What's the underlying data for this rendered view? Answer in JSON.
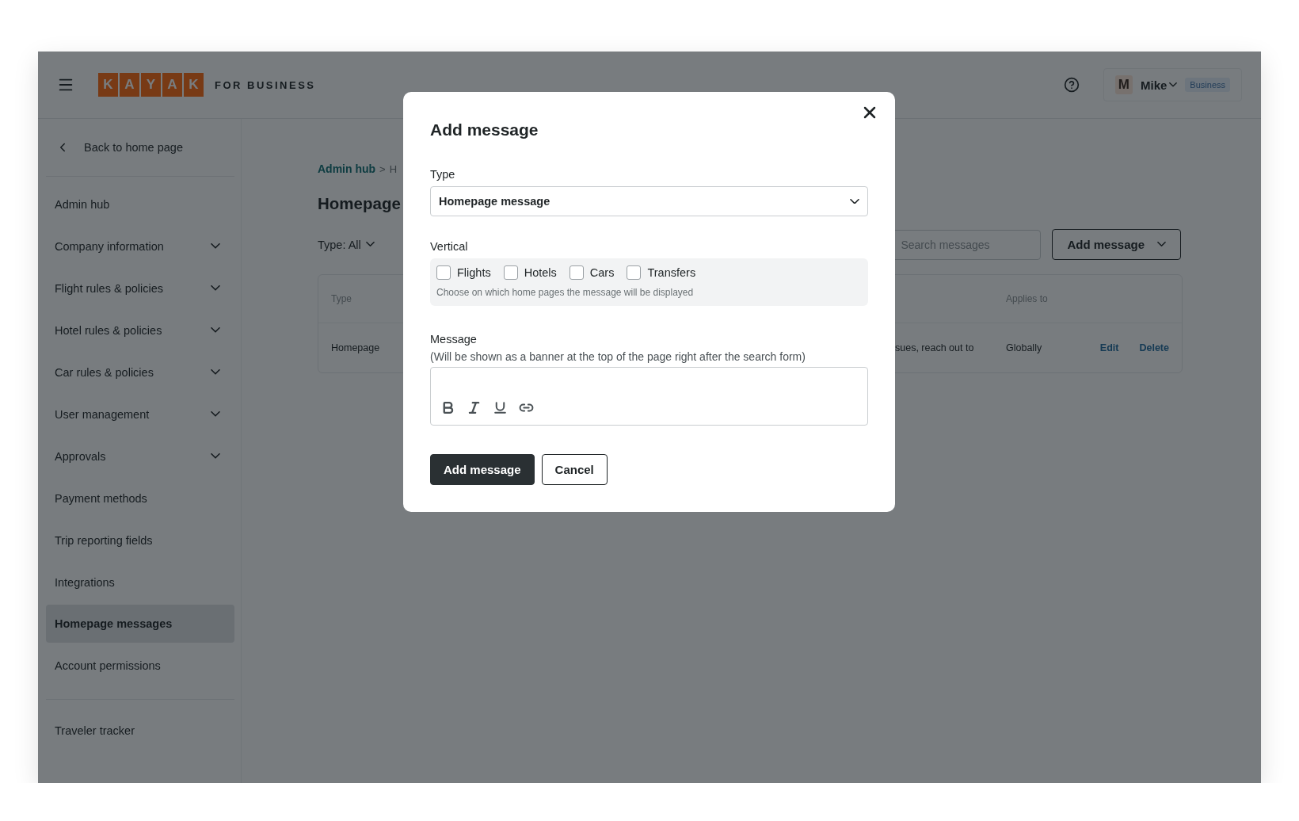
{
  "header": {
    "brand_letters": [
      "K",
      "A",
      "Y",
      "A",
      "K"
    ],
    "brand_suffix": "FOR BUSINESS",
    "user": {
      "initial": "M",
      "name": "Mike",
      "plan": "Business"
    }
  },
  "sidebar": {
    "back": "Back to home page",
    "items": [
      {
        "label": "Admin hub",
        "expandable": false,
        "selected": false
      },
      {
        "label": "Company information",
        "expandable": true,
        "selected": false
      },
      {
        "label": "Flight rules & policies",
        "expandable": true,
        "selected": false
      },
      {
        "label": "Hotel rules & policies",
        "expandable": true,
        "selected": false
      },
      {
        "label": "Car rules & policies",
        "expandable": true,
        "selected": false
      },
      {
        "label": "User management",
        "expandable": true,
        "selected": false
      },
      {
        "label": "Approvals",
        "expandable": true,
        "selected": false
      },
      {
        "label": "Payment methods",
        "expandable": false,
        "selected": false
      },
      {
        "label": "Trip reporting fields",
        "expandable": false,
        "selected": false
      },
      {
        "label": "Integrations",
        "expandable": false,
        "selected": false
      },
      {
        "label": "Homepage messages",
        "expandable": false,
        "selected": true
      },
      {
        "label": "Account permissions",
        "expandable": false,
        "selected": false
      }
    ],
    "footer_items": [
      "Traveler tracker"
    ]
  },
  "main": {
    "breadcrumb": {
      "link": "Admin hub",
      "separator": ">",
      "current": "H"
    },
    "title": "Homepage",
    "filter": {
      "label": "Type:",
      "value": "All"
    },
    "search": {
      "placeholder": "Search messages"
    },
    "add_button": "Add message",
    "table": {
      "columns": {
        "type": "Type",
        "applies_to": "Applies to"
      },
      "rows": [
        {
          "type": "Homepage",
          "message": "sues, reach out to",
          "applies_to": "Globally",
          "actions": [
            "Edit",
            "Delete"
          ]
        }
      ]
    }
  },
  "modal": {
    "title": "Add message",
    "type_field": {
      "label": "Type",
      "value": "Homepage message"
    },
    "vertical": {
      "label": "Vertical",
      "options": [
        {
          "label": "Flights",
          "checked": false
        },
        {
          "label": "Hotels",
          "checked": false
        },
        {
          "label": "Cars",
          "checked": false
        },
        {
          "label": "Transfers",
          "checked": false
        }
      ],
      "hint": "Choose on which home pages the message will be displayed"
    },
    "message": {
      "label": "Message",
      "hint": "(Will be shown as a banner at the top of the page right after the search form)"
    },
    "buttons": [
      {
        "label": "Add message",
        "kind": "primary"
      },
      {
        "label": "Cancel",
        "kind": "secondary"
      }
    ]
  }
}
